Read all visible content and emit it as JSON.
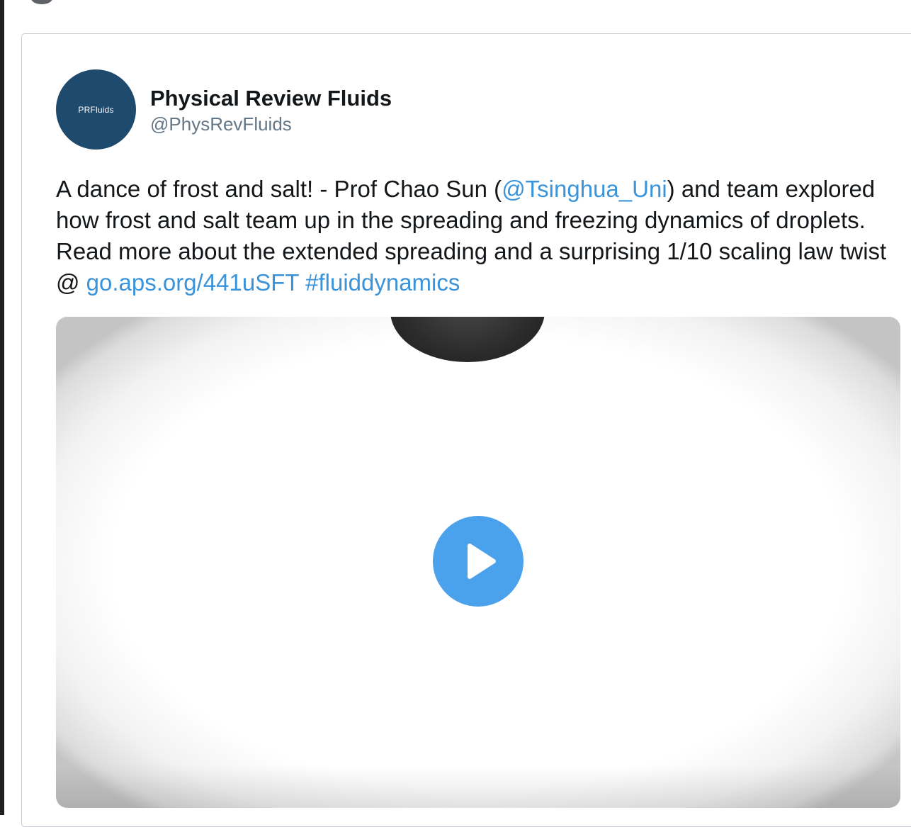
{
  "author": {
    "avatar_text": "PRFluids",
    "name": "Physical Review Fluids",
    "handle": "@PhysRevFluids"
  },
  "tweet": {
    "text_1": "A dance of frost and salt! - Prof Chao Sun (",
    "mention": "@Tsinghua_Uni",
    "text_2": ") and team explored how frost and salt team up in the spreading and freezing dynamics of droplets. Read more about the extended spreading and a surprising 1/10 scaling law twist @ ",
    "link": "go.aps.org/441uSFT",
    "hashtag": "#fluiddynamics"
  },
  "media": {
    "play_icon": "play-icon"
  },
  "colors": {
    "avatar_bg": "#1e4a6e",
    "link": "#3b94d9",
    "play_button": "#4aa1ec",
    "handle": "#657786"
  }
}
